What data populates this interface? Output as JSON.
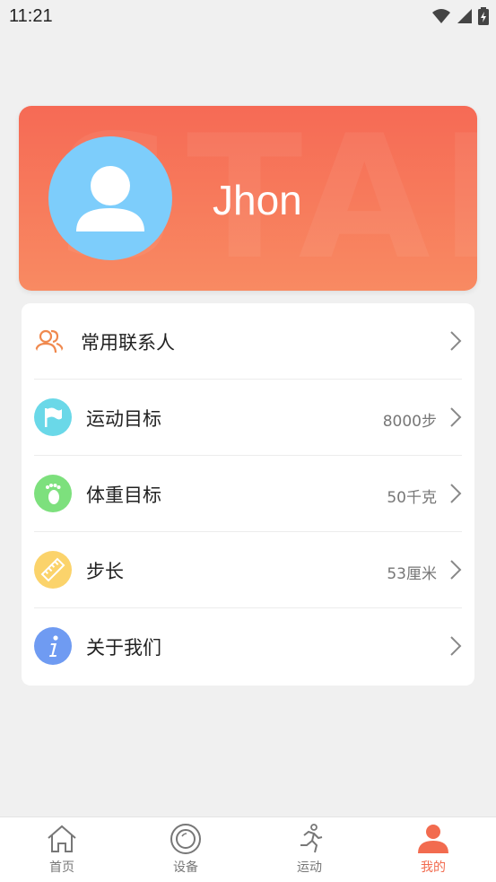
{
  "status_bar": {
    "time": "11:21"
  },
  "profile": {
    "name": "Jhon",
    "watermark": "START"
  },
  "menu": {
    "items": [
      {
        "label": "常用联系人",
        "value": "",
        "icon": "contacts-icon"
      },
      {
        "label": "运动目标",
        "value": "8000步",
        "icon": "flag-icon"
      },
      {
        "label": "体重目标",
        "value": "50千克",
        "icon": "footprint-icon"
      },
      {
        "label": "步长",
        "value": "53厘米",
        "icon": "ruler-icon"
      },
      {
        "label": "关于我们",
        "value": "",
        "icon": "info-icon"
      }
    ]
  },
  "bottom_nav": {
    "items": [
      {
        "label": "首页",
        "icon": "home-icon"
      },
      {
        "label": "设备",
        "icon": "device-icon"
      },
      {
        "label": "运动",
        "icon": "running-icon"
      },
      {
        "label": "我的",
        "icon": "profile-icon",
        "active": true
      }
    ]
  },
  "colors": {
    "accent": "#f26b4f",
    "card_gradient_top": "#f66a55",
    "card_gradient_bottom": "#f88a62",
    "avatar_bg": "#7dcdfb",
    "flag_bg": "#6ad8e8",
    "foot_bg": "#7de07d",
    "ruler_bg": "#fbd36b",
    "info_bg": "#6f9bf2"
  }
}
